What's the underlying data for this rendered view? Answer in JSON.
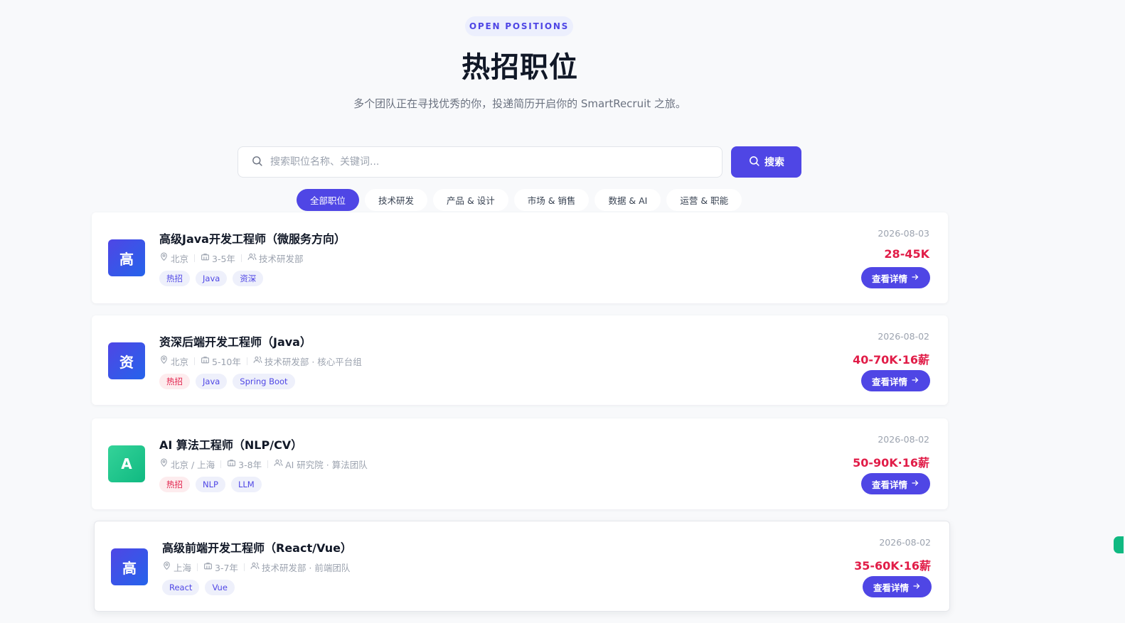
{
  "hero": {
    "eyebrow": "OPEN POSITIONS",
    "title": "热招职位",
    "subtitle": "多个团队正在寻找优秀的你，投递简历开启你的 SmartRecruit 之旅。"
  },
  "search": {
    "placeholder": "搜索职位名称、关键词...",
    "value": "",
    "button_label": "搜索",
    "icon": "search-icon"
  },
  "filters": [
    {
      "label": "全部职位",
      "active": true
    },
    {
      "label": "技术研发",
      "active": false
    },
    {
      "label": "产品 & 设计",
      "active": false
    },
    {
      "label": "市场 & 销售",
      "active": false
    },
    {
      "label": "数据 & AI",
      "active": false
    },
    {
      "label": "运营 & 职能",
      "active": false
    }
  ],
  "jobs": [
    {
      "avatar": "高",
      "avatar_color": "#4f46e5",
      "title": "高级Java开发工程师（微服务方向）",
      "location": "北京",
      "experience": "3-5年",
      "department": "技术研发部",
      "tags": [
        {
          "label": "热招",
          "hot": false
        },
        {
          "label": "Java",
          "hot": false
        },
        {
          "label": "资深",
          "hot": false
        }
      ],
      "date": "2026-08-03",
      "salary": "28-45K",
      "action": "查看详情"
    },
    {
      "avatar": "资",
      "avatar_color": "#4f46e5",
      "title": "资深后端开发工程师（Java）",
      "location": "北京",
      "experience": "5-10年",
      "department": "技术研发部 · 核心平台组",
      "tags": [
        {
          "label": "热招",
          "hot": true
        },
        {
          "label": "Java",
          "hot": false
        },
        {
          "label": "Spring Boot",
          "hot": false
        }
      ],
      "date": "2026-08-02",
      "salary": "40-70K·16薪",
      "action": "查看详情"
    },
    {
      "avatar": "A",
      "avatar_color": "#10b981",
      "title": "AI 算法工程师（NLP/CV）",
      "location": "北京 / 上海",
      "experience": "3-8年",
      "department": "AI 研究院 · 算法团队",
      "tags": [
        {
          "label": "热招",
          "hot": true
        },
        {
          "label": "NLP",
          "hot": false
        },
        {
          "label": "LLM",
          "hot": false
        }
      ],
      "date": "2026-08-02",
      "salary": "50-90K·16薪",
      "action": "查看详情"
    },
    {
      "avatar": "高",
      "avatar_color": "#4f46e5",
      "title": "高级前端开发工程师（React/Vue）",
      "location": "上海",
      "experience": "3-7年",
      "department": "技术研发部 · 前端团队",
      "tags": [
        {
          "label": "React",
          "hot": false
        },
        {
          "label": "Vue",
          "hot": false
        }
      ],
      "date": "2026-08-02",
      "salary": "35-60K·16薪",
      "action": "查看详情"
    }
  ],
  "colors": {
    "accent": "#4f46e5",
    "salary": "#e11d48",
    "hot_tag_bg": "#fdecee",
    "tag_bg": "#eef0fb",
    "page_bg": "#f8f9fb"
  }
}
